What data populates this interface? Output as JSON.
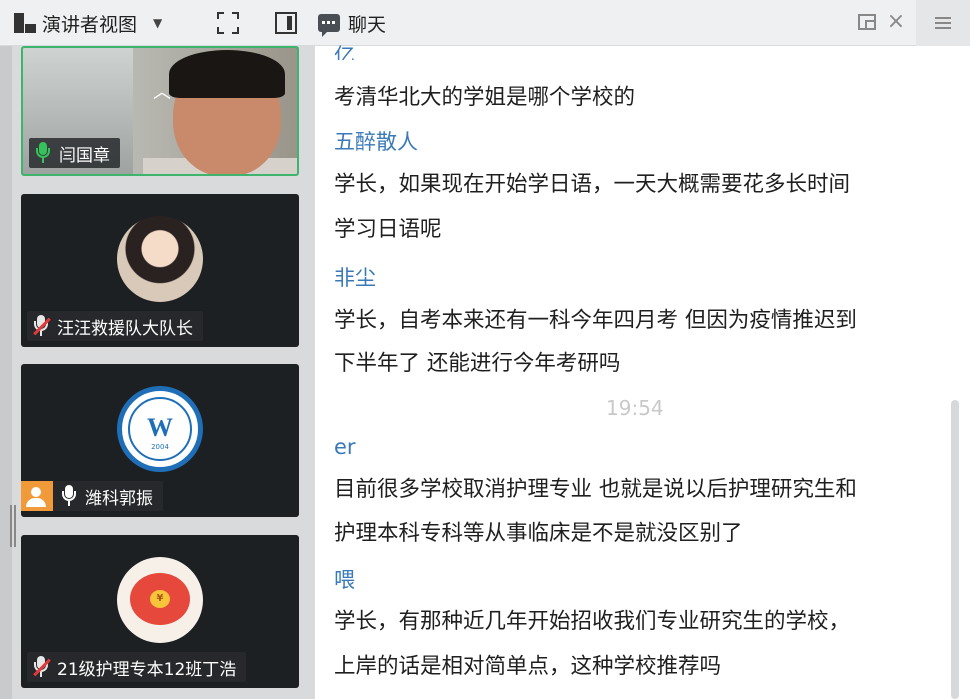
{
  "toolbar": {
    "view_mode_label": "演讲者视图",
    "chat_title": "聊天",
    "close_glyph": "×"
  },
  "participants": [
    {
      "name": "闫国章",
      "mic": "on",
      "video": true,
      "active": true
    },
    {
      "name": "汪汪救援队大队长",
      "mic": "muted",
      "video": false
    },
    {
      "name": "潍科郭振",
      "mic": "on",
      "video": false
    },
    {
      "name": "21级护理专本12班丁浩",
      "mic": "muted",
      "video": false
    }
  ],
  "avatar_logo": {
    "letter": "W",
    "year": "2004"
  },
  "avatar_pig": {
    "coin": "¥"
  },
  "chat": {
    "partial_name": "亿",
    "messages": [
      {
        "id": "m1",
        "name": null,
        "lines": [
          "考清华北大的学姐是哪个学校的"
        ]
      },
      {
        "id": "m2",
        "name": "五醉散人",
        "lines": [
          "学长，如果现在开始学日语，一天大概需要花多长时间",
          "学习日语呢"
        ]
      },
      {
        "id": "m3",
        "name": "非尘",
        "lines": [
          "学长，自考本来还有一科今年四月考 但因为疫情推迟到",
          "下半年了 还能进行今年考研吗"
        ]
      },
      {
        "id": "m4",
        "name": "er",
        "lines": [
          "目前很多学校取消护理专业 也就是说以后护理研究生和",
          "护理本科专科等从事临床是不是就没区别了"
        ]
      },
      {
        "id": "m5",
        "name": "喂",
        "lines": [
          "学长，有那种近几年开始招收我们专业研究生的学校，",
          "上岸的话是相对简单点，这种学校推荐吗"
        ]
      }
    ],
    "timestamp": "19:54"
  },
  "colors": {
    "sender_name": "#3a7ab8",
    "active_border": "#3fb46c",
    "mic_on": "#35c25b",
    "mic_muted_slash": "#e23a3a"
  }
}
